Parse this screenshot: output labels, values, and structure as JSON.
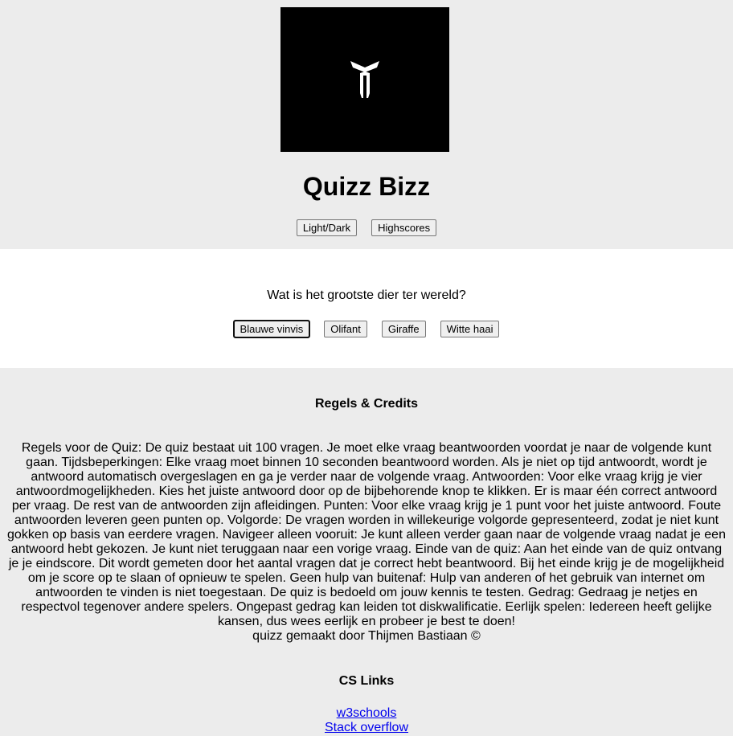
{
  "header": {
    "title": "Quizz Bizz",
    "theme_button": "Light/Dark",
    "highscores_button": "Highscores",
    "logo_icon": "t-logo-icon"
  },
  "quiz": {
    "question": "Wat is het grootste dier ter wereld?",
    "answers": [
      "Blauwe vinvis",
      "Olifant",
      "Giraffe",
      "Witte haai"
    ]
  },
  "footer": {
    "credits_title": "Regels & Credits",
    "rules_text": "Regels voor de Quiz: De quiz bestaat uit 100 vragen. Je moet elke vraag beantwoorden voordat je naar de volgende kunt gaan. Tijdsbeperkingen: Elke vraag moet binnen 10 seconden beantwoord worden. Als je niet op tijd antwoordt, wordt je antwoord automatisch overgeslagen en ga je verder naar de volgende vraag. Antwoorden: Voor elke vraag krijg je vier antwoordmogelijkheden. Kies het juiste antwoord door op de bijbehorende knop te klikken. Er is maar één correct antwoord per vraag. De rest van de antwoorden zijn afleidingen. Punten: Voor elke vraag krijg je 1 punt voor het juiste antwoord. Foute antwoorden leveren geen punten op. Volgorde: De vragen worden in willekeurige volgorde gepresenteerd, zodat je niet kunt gokken op basis van eerdere vragen. Navigeer alleen vooruit: Je kunt alleen verder gaan naar de volgende vraag nadat je een antwoord hebt gekozen. Je kunt niet teruggaan naar een vorige vraag. Einde van de quiz: Aan het einde van de quiz ontvang je je eindscore. Dit wordt gemeten door het aantal vragen dat je correct hebt beantwoord. Bij het einde krijg je de mogelijkheid om je score op te slaan of opnieuw te spelen. Geen hulp van buitenaf: Hulp van anderen of het gebruik van internet om antwoorden te vinden is niet toegestaan. De quiz is bedoeld om jouw kennis te testen. Gedrag: Gedraag je netjes en respectvol tegenover andere spelers. Ongepast gedrag kan leiden tot diskwalificatie. Eerlijk spelen: Iedereen heeft gelijke kansen, dus wees eerlijk en probeer je best te doen!",
    "author": "quizz gemaakt door Thijmen Bastiaan ©",
    "links_title": "CS Links",
    "links": [
      "w3schools",
      "Stack overflow"
    ]
  }
}
